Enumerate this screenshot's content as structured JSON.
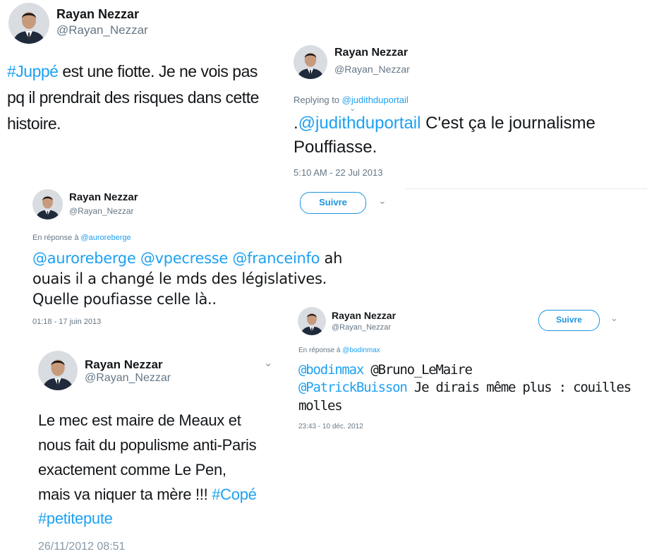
{
  "colors": {
    "link": "#1da1f2",
    "muted": "#657786",
    "text": "#14171a",
    "follow_border": "#1b95e0"
  },
  "tweet1": {
    "name": "Rayan Nezzar",
    "handle": "@Rayan_Nezzar",
    "hashtag": "#Juppé",
    "line1_rest": " est une fiotte. Je ne vois pas",
    "line2": "pq il prendrait des risques dans cette",
    "line3": "histoire."
  },
  "tweet2": {
    "name": "Rayan Nezzar",
    "handle": "@Rayan_Nezzar",
    "replying_prefix": "Replying to ",
    "replying_to": "@judithduportail",
    "mention": "@judithduportail",
    "line1_lead": ".",
    "line1_rest": " C'est ça le journalisme",
    "line2": "Pouffiasse.",
    "timestamp": "5:10 AM - 22 Jul 2013"
  },
  "tweet3": {
    "name": "Rayan Nezzar",
    "handle": "@Rayan_Nezzar",
    "follow_label": "Suivre",
    "reply_prefix": "En réponse à ",
    "reply_to": "@auroreberge",
    "mention1": "@auroreberge",
    "mention2": "@vpecresse",
    "mention3": "@franceinfo",
    "line1_rest": " ah",
    "line2": "ouais il a changé le mds des législatives.",
    "line3": "Quelle poufiasse celle là..",
    "timestamp": "01:18 - 17 juin 2013"
  },
  "tweet4": {
    "name": "Rayan Nezzar",
    "handle": "@Rayan_Nezzar",
    "follow_label": "Suivre",
    "reply_prefix": "En réponse à ",
    "reply_to": "@bodinmax",
    "mention1": "@bodinmax",
    "line1_rest": " @Bruno_LeMaire",
    "mention2": "@PatrickBuisson",
    "line2_rest": " Je dirais même plus : couilles",
    "line3": "molles",
    "timestamp": "23:43 - 10 déc. 2012"
  },
  "tweet5": {
    "name": "Rayan Nezzar",
    "handle": "@Rayan_Nezzar",
    "line1": "Le mec est maire de Meaux et",
    "line2": "nous fait du populisme anti-Paris",
    "line3": "exactement comme Le Pen,",
    "line4_lead": "mais va niquer ta mère !!! ",
    "hashtag1": "#Copé",
    "hashtag2": "#petitepute",
    "timestamp": "26/11/2012 08:51"
  }
}
